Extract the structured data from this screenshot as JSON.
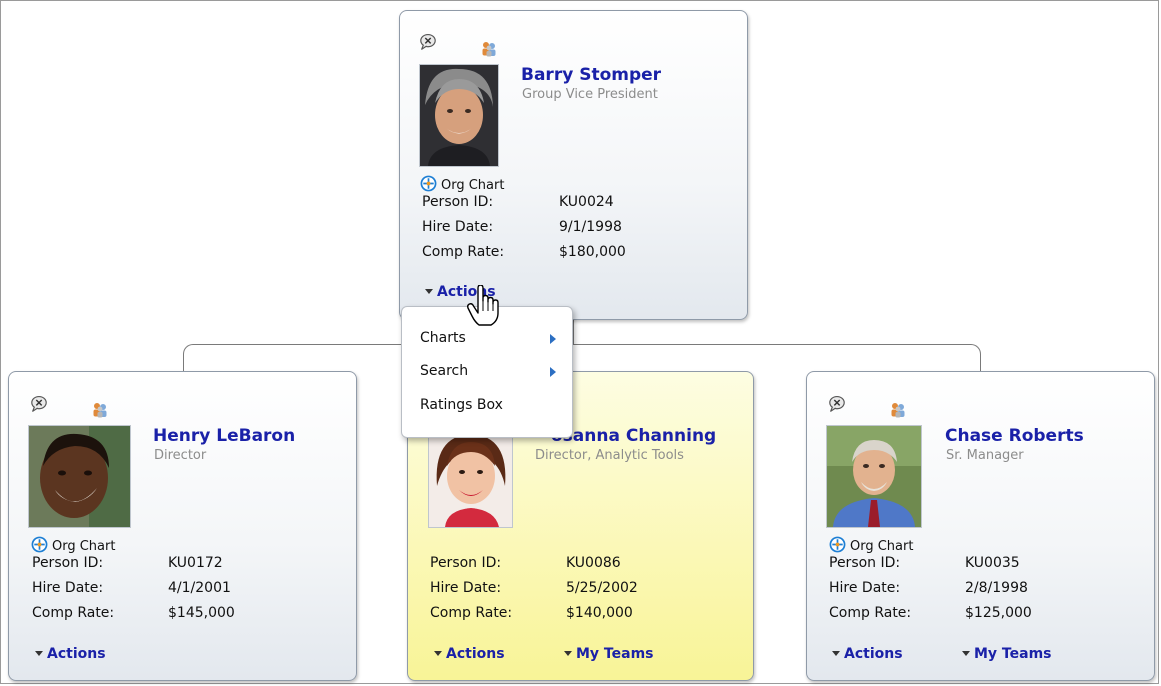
{
  "manager": {
    "name": "Barry Stomper",
    "title": "Group Vice President",
    "org_chart_label": "Org Chart",
    "fields": [
      {
        "label": "Person ID:",
        "value": "KU0024"
      },
      {
        "label": "Hire Date:",
        "value": "9/1/1998"
      },
      {
        "label": "Comp Rate:",
        "value": "$180,000"
      }
    ],
    "actions_label": "Actions"
  },
  "actions_menu": {
    "items": [
      {
        "label": "Charts",
        "has_submenu": true
      },
      {
        "label": "Search",
        "has_submenu": true
      },
      {
        "label": "Ratings Box",
        "has_submenu": false
      }
    ]
  },
  "reports": [
    {
      "name": "Henry LeBaron",
      "title": "Director",
      "org_chart_label": "Org Chart",
      "fields": [
        {
          "label": "Person ID:",
          "value": "KU0172"
        },
        {
          "label": "Hire Date:",
          "value": "4/1/2001"
        },
        {
          "label": "Comp Rate:",
          "value": "$145,000"
        }
      ],
      "actions_label": "Actions"
    },
    {
      "name": "Rosanna Channing",
      "name_visible": "osanna Channing",
      "title": "Director, Analytic Tools",
      "fields": [
        {
          "label": "Person ID:",
          "value": "KU0086"
        },
        {
          "label": "Hire Date:",
          "value": "5/25/2002"
        },
        {
          "label": "Comp Rate:",
          "value": "$140,000"
        }
      ],
      "actions_label": "Actions",
      "teams_label": "My Teams"
    },
    {
      "name": "Chase Roberts",
      "title": "Sr. Manager",
      "org_chart_label": "Org Chart",
      "fields": [
        {
          "label": "Person ID:",
          "value": "KU0035"
        },
        {
          "label": "Hire Date:",
          "value": "2/8/1998"
        },
        {
          "label": "Comp Rate:",
          "value": "$125,000"
        }
      ],
      "actions_label": "Actions",
      "teams_label": "My Teams"
    }
  ],
  "icons": {
    "card_top_left": "close-bubble-icon",
    "card_top_right": "people-group-icon",
    "org_chart": "target-crosshair-icon",
    "cursor": "hand-pointer-icon"
  },
  "colors": {
    "link": "#1a21a8",
    "highlight_card": "#fbf8b5",
    "submenu_arrow": "#2c6fc2"
  }
}
